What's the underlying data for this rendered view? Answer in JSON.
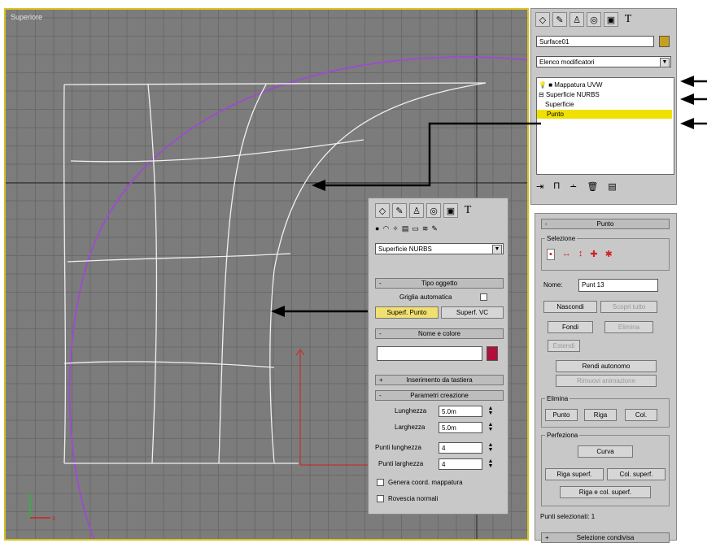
{
  "viewport": {
    "label": "Superiore"
  },
  "top_panel": {
    "object_name": "Surface01",
    "modifier_list": "Elenco modificatori",
    "stack": [
      "Mappatura UVW",
      "Superficie NURBS",
      "Superficie",
      "Punto"
    ]
  },
  "float_panel": {
    "dropdown": "Superficie NURBS",
    "tipo_oggetto": "Tipo oggetto",
    "griglia": "Griglia automatica",
    "btn_punti": "Superf. Punto",
    "btn_vc": "Superf. VC",
    "nome_colore": "Nome e colore",
    "inserimento": "Inserimento da tastiera",
    "parametri": "Parametri creazione",
    "lunghezza_label": "Lunghezza",
    "lunghezza_val": "5.0m",
    "larghezza_label": "Larghezza",
    "larghezza_val": "5.0m",
    "punti_lung_label": "Punti lunghezza",
    "punti_lung_val": "4",
    "punti_larg_label": "Punti larghezza",
    "punti_larg_val": "4",
    "genera": "Genera coord. mappatura",
    "rovescia": "Rovescia normali"
  },
  "right_panel": {
    "rollout": "Punto",
    "selezione": "Selezione",
    "nome_label": "Nome:",
    "nome_val": "Punt 13",
    "nascondi": "Nascondi",
    "scopri": "Scopri tutto",
    "fondi": "Fondi",
    "elimina": "Elimina",
    "estendi": "Estendi",
    "rendi_auto": "Rendi autonomo",
    "rimuovi_anim": "Rimuovi animazione",
    "elimina_grp": "Elimina",
    "punto": "Punto",
    "riga": "Riga",
    "col": "Col.",
    "perfeziona": "Perfeziona",
    "curva": "Curva",
    "riga_superf": "Riga superf.",
    "col_superf": "Col. superf.",
    "riga_col": "Riga e col. superf.",
    "status": "Punti selezionati: 1",
    "sel_condivisa": "Selezione condivisa"
  },
  "colors": {
    "viewport_bg": "#7c7c7c",
    "grid_minor": "#707070",
    "highlight": "#f0e000",
    "purple_curve": "#9a4fc8",
    "swatch": "#b0103c"
  }
}
